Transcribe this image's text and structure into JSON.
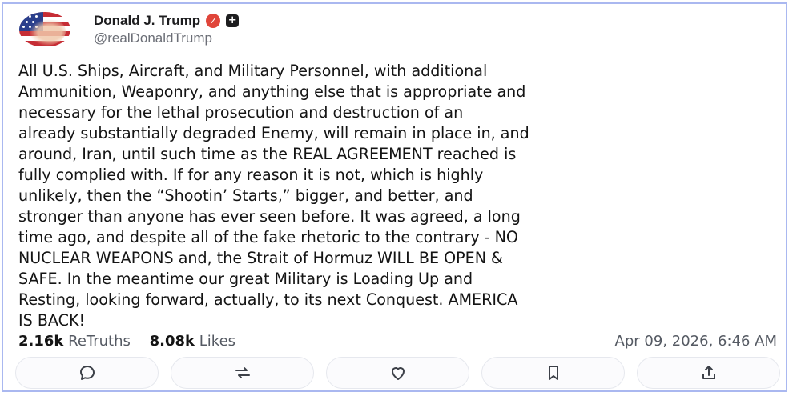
{
  "post": {
    "author": {
      "display_name": "Donald J. Trump",
      "handle": "@realDonaldTrump"
    },
    "text": "All U.S. Ships, Aircraft, and Military Personnel, with additional\nAmmunition, Weaponry, and anything else that is appropriate and\nnecessary for the lethal prosecution and destruction of an\nalready substantially degraded Enemy, will remain in place in, and\naround, Iran, until such time as the REAL AGREEMENT reached is\nfully complied with. If for any reason it is not, which is highly\nunlikely, then the “Shootin’ Starts,” bigger, and better, and\nstronger than anyone has ever seen before. It was agreed, a long\ntime ago, and despite all of the fake rhetoric to the contrary - NO\nNUCLEAR WEAPONS and, the Strait of Hormuz WILL BE OPEN &\nSAFE. In the meantime our great Military is Loading Up and\nResting, looking forward, actually, to its next Conquest. AMERICA\nIS BACK!",
    "stats": {
      "retruths_count": "2.16k",
      "retruths_label": "ReTruths",
      "likes_count": "8.08k",
      "likes_label": "Likes"
    },
    "timestamp": "Apr 09, 2026, 6:46 AM"
  },
  "actions": [
    {
      "name": "reply",
      "icon": "reply-icon"
    },
    {
      "name": "retruth",
      "icon": "retruth-icon"
    },
    {
      "name": "like",
      "icon": "heart-icon"
    },
    {
      "name": "bookmark",
      "icon": "bookmark-icon"
    },
    {
      "name": "share",
      "icon": "share-icon"
    }
  ],
  "colors": {
    "frame_border": "#aab8f0",
    "verified_badge": "#e0453a",
    "text": "#141414",
    "muted": "#555a63"
  }
}
